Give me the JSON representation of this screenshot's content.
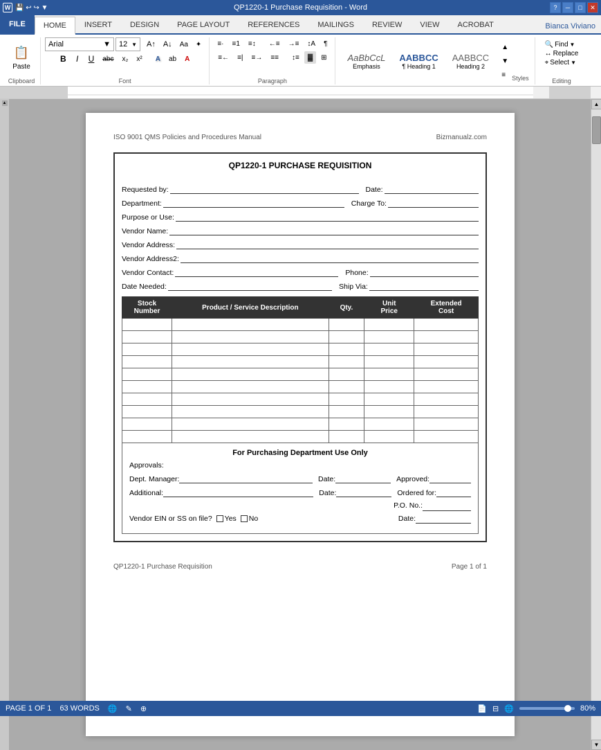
{
  "titleBar": {
    "title": "QP1220-1 Purchase Requisition - Word",
    "helpBtn": "?",
    "minBtn": "─",
    "maxBtn": "□",
    "closeBtn": "✕"
  },
  "ribbonTabs": {
    "tabs": [
      "FILE",
      "HOME",
      "INSERT",
      "DESIGN",
      "PAGE LAYOUT",
      "REFERENCES",
      "MAILINGS",
      "REVIEW",
      "VIEW",
      "ACROBAT"
    ],
    "activeTab": "HOME",
    "user": "Bianca Viviano"
  },
  "toolbar": {
    "clipboard": {
      "label": "Clipboard",
      "paste": "Paste"
    },
    "font": {
      "label": "Font",
      "name": "Arial",
      "size": "12",
      "bold": "B",
      "italic": "I",
      "underline": "U",
      "strikethrough": "abc",
      "subscript": "x₂",
      "superscript": "x²"
    },
    "paragraph": {
      "label": "Paragraph"
    },
    "styles": {
      "label": "Styles",
      "items": [
        {
          "name": "Emphasis",
          "sample": "AaBbCcL"
        },
        {
          "name": "¶ Heading 1",
          "sample": "AABBCC"
        },
        {
          "name": "Heading 2",
          "sample": "AABBCC"
        }
      ]
    },
    "editing": {
      "label": "Editing",
      "find": "Find",
      "replace": "Replace",
      "select": "Select"
    }
  },
  "document": {
    "headerLeft": "ISO 9001 QMS Policies and Procedures Manual",
    "headerRight": "Bizmanualz.com",
    "form": {
      "title": "QP1220-1 PURCHASE REQUISITION",
      "fields": {
        "requestedBy": "Requested by:",
        "date": "Date:",
        "department": "Department:",
        "chargeTo": "Charge To:",
        "purposeOrUse": "Purpose or Use:",
        "vendorName": "Vendor Name:",
        "vendorAddress": "Vendor Address:",
        "vendorAddress2": "Vendor Address2:",
        "vendorContact": "Vendor Contact:",
        "phone": "Phone:",
        "dateNeeded": "Date Needed:",
        "shipVia": "Ship Via:"
      },
      "table": {
        "headers": [
          "Stock Number",
          "Product / Service Description",
          "Qty.",
          "Unit Price",
          "Extended Cost"
        ],
        "rows": 10
      },
      "footer": {
        "sectionTitle": "For Purchasing Department Use Only",
        "approvals": "Approvals:",
        "deptManager": "Dept. Manager:",
        "deptManagerDate": "Date:",
        "approved": "Approved:",
        "additional": "Additional:",
        "additionalDate": "Date:",
        "orderedFor": "Ordered for:",
        "poNo": "P.O. No.:",
        "vendorEIN": "Vendor EIN or SS on file?",
        "yes": "Yes",
        "no": "No",
        "footerDate": "Date:"
      }
    },
    "pageFooterLeft": "QP1220-1 Purchase Requisition",
    "pageFooterRight": "Page 1 of 1"
  },
  "statusBar": {
    "page": "PAGE 1 OF 1",
    "words": "63 WORDS",
    "zoom": "80%"
  }
}
